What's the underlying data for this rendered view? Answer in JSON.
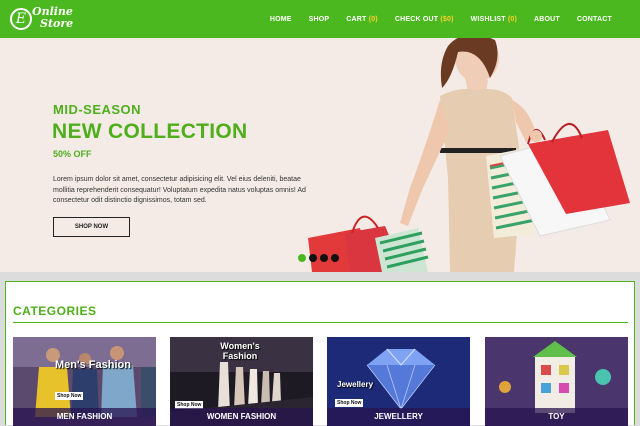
{
  "header": {
    "logo_line1": "Online",
    "logo_line2": "Store",
    "logo_mark": "E",
    "nav": [
      {
        "label": "HOME"
      },
      {
        "label": "SHOP"
      },
      {
        "label": "CART ",
        "count": "(0)"
      },
      {
        "label": "CHECK OUT ",
        "count": "($0)"
      },
      {
        "label": "WISHLIST ",
        "count": "(0)"
      },
      {
        "label": "ABOUT"
      },
      {
        "label": "CONTACT"
      }
    ]
  },
  "hero": {
    "kicker": "MID-SEASON",
    "title": "NEW COLLECTION",
    "subtitle": "50% OFF",
    "body": "Lorem ipsum dolor sit amet, consectetur adipisicing elit. Vel eius deleniti, beatae mollitia reprehenderit consequatur! Voluptatum expedita natus voluptas omnis! Ad consectetur odit distinctio dignissimos, totam sed.",
    "button": "SHOP NOW"
  },
  "categories": {
    "title": "CATEGORIES",
    "items": [
      {
        "label": "MEN FASHION",
        "image_text": "Men's Fashion",
        "shop_badge": "Shop Now"
      },
      {
        "label": "WOMEN FASHION",
        "image_text": "Women's Fashion",
        "shop_badge": "Shop Now"
      },
      {
        "label": "JEWELLERY",
        "image_text": "Jewellery",
        "shop_badge": "Shop Now"
      },
      {
        "label": "TOY",
        "image_text": "",
        "shop_badge": ""
      }
    ]
  },
  "colors": {
    "brand_green": "#4cb81f",
    "hero_bg": "#f4ebe6",
    "badge_yellow": "#ffcf2a"
  }
}
